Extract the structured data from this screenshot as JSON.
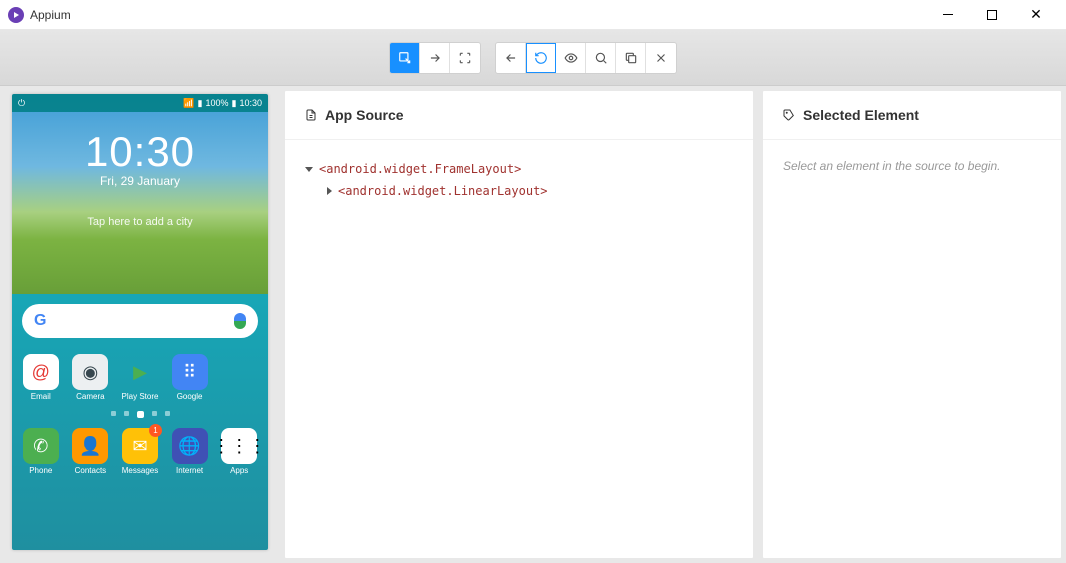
{
  "window": {
    "title": "Appium"
  },
  "source_panel": {
    "title": "App Source"
  },
  "selected_panel": {
    "title": "Selected Element",
    "placeholder": "Select an element in the source to begin."
  },
  "tree": {
    "root": "<android.widget.FrameLayout>",
    "child": "<android.widget.LinearLayout>"
  },
  "phone": {
    "time": "10:30",
    "date": "Fri, 29 January",
    "weather_hint": "Tap here to add a city",
    "battery_pct": "100%",
    "status_time": "10:30",
    "notif_count": "1",
    "apps_row1": [
      {
        "label": "Email",
        "bg": "#fff",
        "glyph": "@",
        "gcolor": "#e53935"
      },
      {
        "label": "Camera",
        "bg": "#eceff1",
        "glyph": "◉",
        "gcolor": "#37474f"
      },
      {
        "label": "Play Store",
        "bg": "transparent",
        "glyph": "▶",
        "gcolor": "#4caf50"
      },
      {
        "label": "Google",
        "bg": "#4285f4",
        "glyph": "⠿",
        "gcolor": "#fff"
      }
    ],
    "apps_row2": [
      {
        "label": "Phone",
        "bg": "#4caf50",
        "glyph": "✆",
        "gcolor": "#fff"
      },
      {
        "label": "Contacts",
        "bg": "#ff9800",
        "glyph": "👤",
        "gcolor": "#fff"
      },
      {
        "label": "Messages",
        "bg": "#ffc107",
        "glyph": "✉",
        "gcolor": "#fff",
        "badge": true
      },
      {
        "label": "Internet",
        "bg": "#3f51b5",
        "glyph": "🌐",
        "gcolor": "#fff"
      },
      {
        "label": "Apps",
        "bg": "#fff",
        "glyph": "⋮⋮⋮",
        "gcolor": "#000"
      }
    ]
  }
}
